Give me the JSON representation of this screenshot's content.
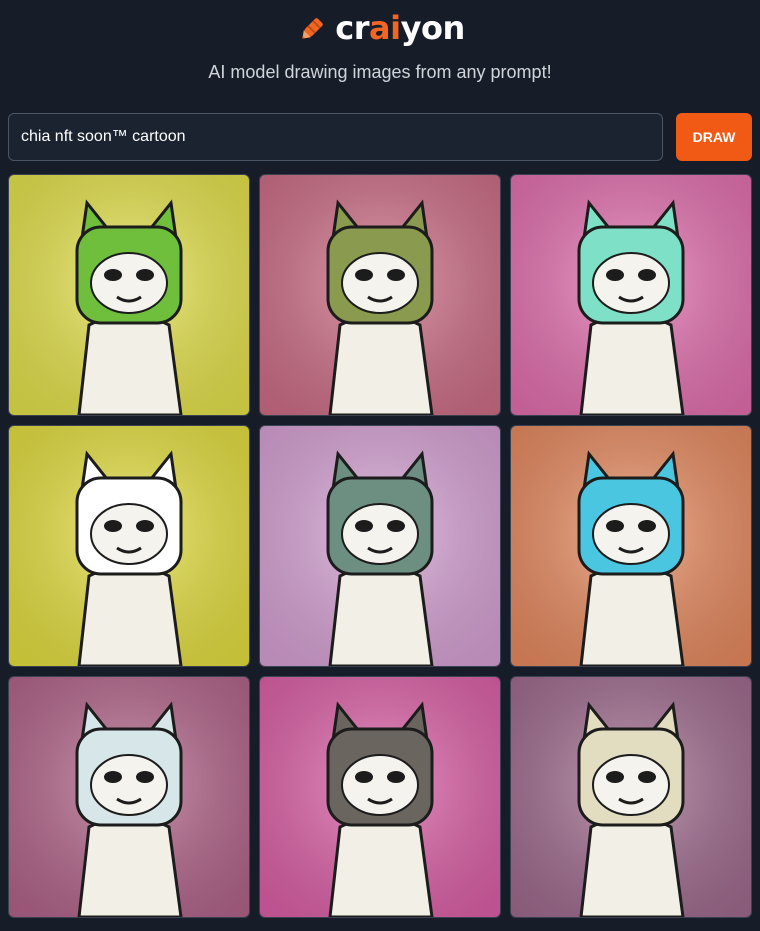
{
  "brand": {
    "logo_pre": "cr",
    "logo_accent": "ai",
    "logo_post": "yon",
    "accent_color": "#f26522",
    "icon": "crayon-icon"
  },
  "subtitle": "AI model drawing images from any prompt!",
  "search": {
    "value": "chia nft soon™ cartoon",
    "button_label": "DRAW"
  },
  "images": [
    {
      "bg": "#e7e54a",
      "accent": "#6fbf3c"
    },
    {
      "bg": "#cf6d86",
      "accent": "#8a9a4e"
    },
    {
      "bg": "#e56fb0",
      "accent": "#7fe0c8"
    },
    {
      "bg": "#e6e13e",
      "accent": "#ffffff"
    },
    {
      "bg": "#d8a2d6",
      "accent": "#6c8f82"
    },
    {
      "bg": "#e98a5e",
      "accent": "#4ac6e0"
    },
    {
      "bg": "#b3638a",
      "accent": "#d7e6e8"
    },
    {
      "bg": "#de5fa8",
      "accent": "#6b6560"
    },
    {
      "bg": "#a06a8e",
      "accent": "#e2dcc0"
    }
  ]
}
